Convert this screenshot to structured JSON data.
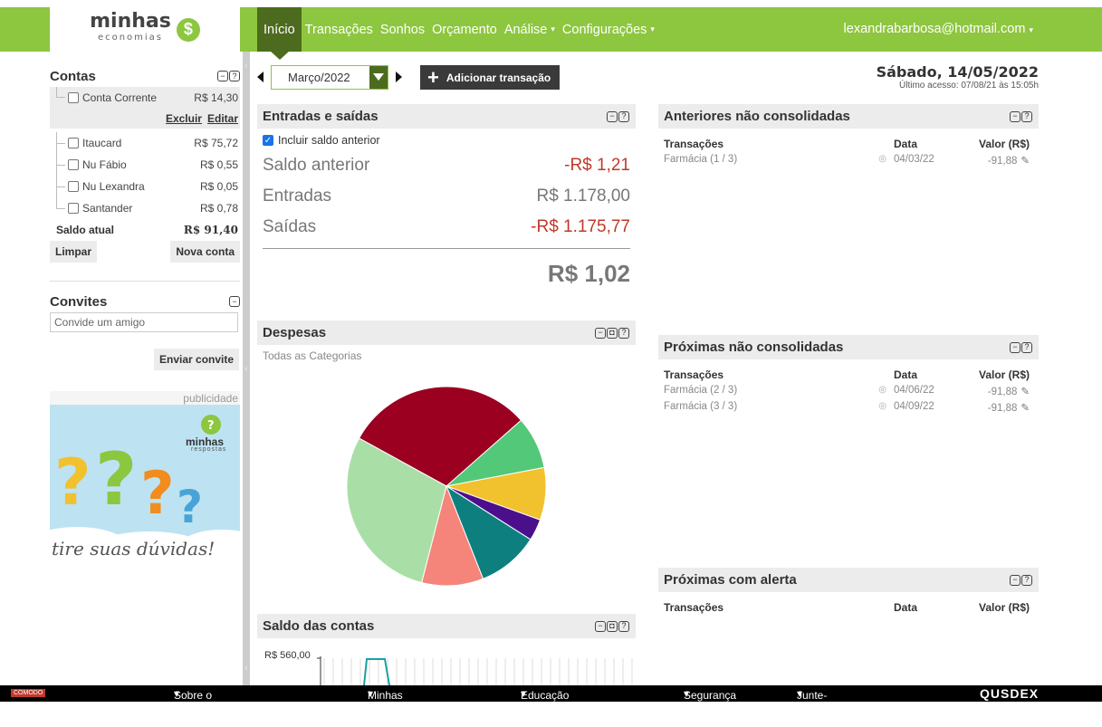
{
  "brand": {
    "name": "minhas",
    "sub": "economias",
    "coin": "$"
  },
  "nav": {
    "items": [
      {
        "label": "Início",
        "active": true
      },
      {
        "label": "Transações"
      },
      {
        "label": "Sonhos"
      },
      {
        "label": "Orçamento"
      },
      {
        "label": "Análise",
        "caret": true
      },
      {
        "label": "Configurações",
        "caret": true
      }
    ],
    "user": "lexandrabarbosa@hotmail.com"
  },
  "contas": {
    "title": "Contas",
    "accounts": [
      {
        "name": "Conta Corrente",
        "value": "R$ 14,30"
      },
      {
        "name": "Itaucard",
        "value": "R$ 75,72"
      },
      {
        "name": "Nu Fábio",
        "value": "R$ 0,55"
      },
      {
        "name": "Nu Lexandra",
        "value": "R$ 0,05"
      },
      {
        "name": "Santander",
        "value": "R$ 0,78"
      }
    ],
    "excluir": "Excluir",
    "editar": "Editar",
    "saldo_label": "Saldo atual",
    "saldo_value": "R$ 91,40",
    "limpar": "Limpar",
    "nova": "Nova conta"
  },
  "convites": {
    "title": "Convites",
    "placeholder": "Convide um amigo",
    "button": "Enviar convite"
  },
  "publicidade": {
    "label": "publicidade",
    "ad_brand": "minhas",
    "ad_sub": "respostas",
    "caption": "tire suas dúvidas!"
  },
  "month": {
    "value": "Março/2022"
  },
  "add_button": "Adicionar transação",
  "date": {
    "day": "Sábado, 14/05/2022",
    "last": "Último acesso: 07/08/21 às 15:05h"
  },
  "entradas": {
    "title": "Entradas e saídas",
    "include": "Incluir saldo anterior",
    "rows": [
      {
        "label": "Saldo anterior",
        "value": "-R$ 1,21",
        "neg": true
      },
      {
        "label": "Entradas",
        "value": "R$ 1.178,00"
      },
      {
        "label": "Saídas",
        "value": "-R$ 1.175,77",
        "neg": true
      }
    ],
    "total": "R$ 1,02"
  },
  "despesas": {
    "title": "Despesas",
    "sub": "Todas as Categorias"
  },
  "saldo_contas": {
    "title": "Saldo das contas",
    "tick": "R$ 560,00"
  },
  "anteriores": {
    "title": "Anteriores não consolidadas",
    "cols": [
      "Transações",
      "Data",
      "Valor (R$)"
    ],
    "rows": [
      {
        "t": "Farmácia (1 / 3)",
        "d": "04/03/22",
        "v": "-91,88"
      }
    ]
  },
  "proximas": {
    "title": "Próximas não consolidadas",
    "cols": [
      "Transações",
      "Data",
      "Valor (R$)"
    ],
    "rows": [
      {
        "t": "Farmácia (2 / 3)",
        "d": "04/06/22",
        "v": "-91,88"
      },
      {
        "t": "Farmácia (3 / 3)",
        "d": "04/09/22",
        "v": "-91,88"
      }
    ]
  },
  "alerta": {
    "title": "Próximas com alerta",
    "cols": [
      "Transações",
      "Data",
      "Valor (R$)"
    ]
  },
  "footer": {
    "items": [
      "Sobre o Minhas Economias",
      "Minhas Economias",
      "Educação Financeira",
      "Segurança",
      "Junte-se a nós"
    ],
    "seal": "COMODO",
    "brand": "QUSDEX"
  },
  "chart_data": {
    "type": "pie",
    "title": "",
    "values": [
      30.5,
      8.5,
      8.5,
      3.5,
      10,
      10,
      29
    ],
    "colors": [
      "#9b0020",
      "#52c878",
      "#f2c12e",
      "#4b0f8c",
      "#0e7f7f",
      "#f5847a",
      "#a9dfa7"
    ]
  }
}
